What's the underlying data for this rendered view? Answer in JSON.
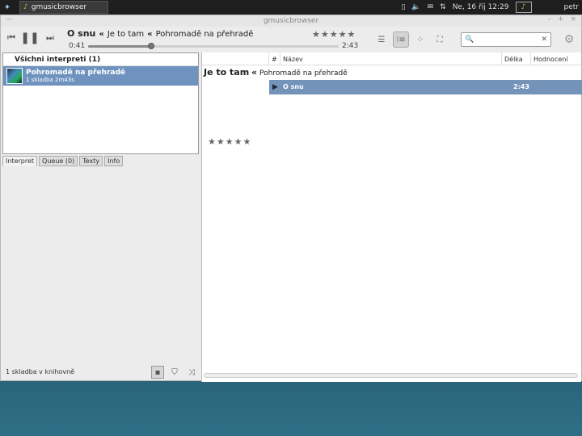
{
  "panel": {
    "app_task": "gmusicbrowser",
    "datetime": "Ne, 16 říj 12:29",
    "user": "petr"
  },
  "window": {
    "title": "gmusicbrowser",
    "left_glyph": "—",
    "controls": [
      "–",
      "+",
      "×"
    ]
  },
  "player": {
    "song_title": "O snu",
    "separator": "«",
    "artist": "Je to tam",
    "album": "Pohromadě na přehradě",
    "elapsed": "0:41",
    "total": "2:43",
    "progress": 0.25,
    "rating_stars": "★★★★★",
    "search_placeholder": ""
  },
  "left": {
    "artists_header": "Všichni interpreti (1)",
    "album_title": "Pohromadě na přehradě",
    "album_tracks": "1 skladba",
    "album_length": "2m43s",
    "tabs": [
      "Interpret",
      "Queue (0)",
      "Texty",
      "Info"
    ],
    "library_count": "1 skladba v knihovně"
  },
  "songlist": {
    "columns": [
      "#",
      "Název",
      "Délka",
      "Hodnocení"
    ],
    "group_artist": "Je to tam",
    "group_sep": "«",
    "group_album": "Pohromadě na přehradě",
    "rows": [
      {
        "title": "O snu",
        "length": "2:43"
      }
    ],
    "rating_stars": "★★★★★"
  },
  "colors": {
    "selection": "#7493b9",
    "album_selection": "#6f93be"
  }
}
